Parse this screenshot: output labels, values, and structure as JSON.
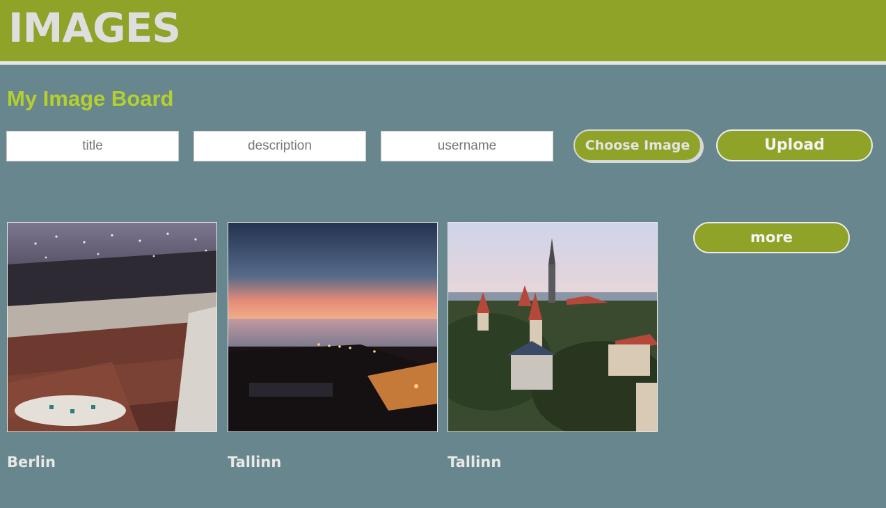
{
  "header": {
    "title": "IMAGES"
  },
  "board": {
    "title": "My Image Board"
  },
  "form": {
    "title_placeholder": "title",
    "description_placeholder": "description",
    "username_placeholder": "username",
    "choose_label": "Choose Image",
    "upload_label": "Upload"
  },
  "images": [
    {
      "title": "Berlin",
      "scene": "concert hall interior"
    },
    {
      "title": "Tallinn",
      "scene": "sunset over sea"
    },
    {
      "title": "Tallinn",
      "scene": "old town towers"
    }
  ],
  "more_label": "more",
  "colors": {
    "background": "#68868d",
    "accent": "#8ea327",
    "title_green": "#b4d12b"
  }
}
